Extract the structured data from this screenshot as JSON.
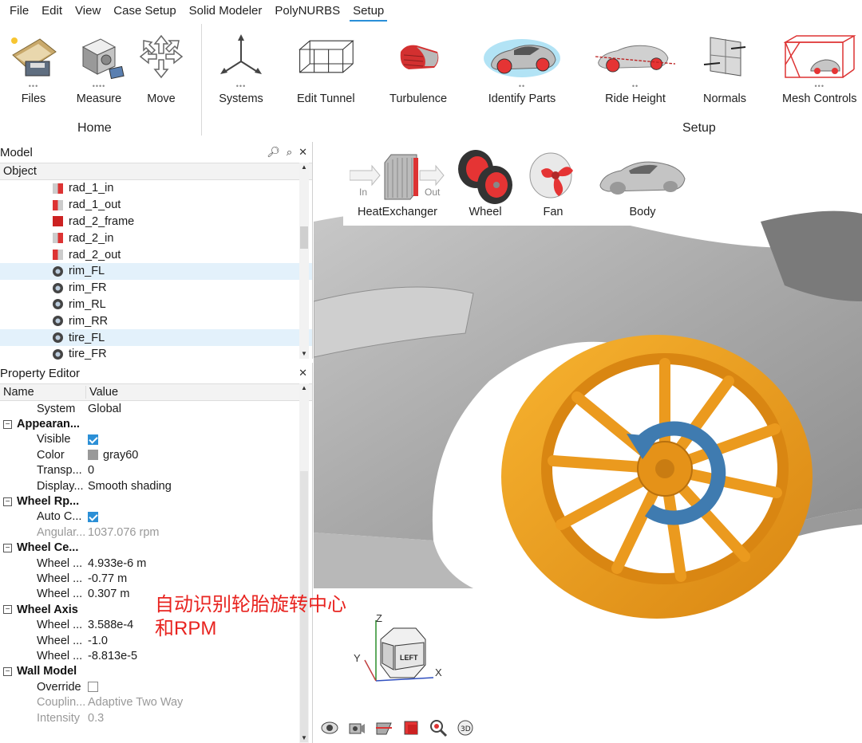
{
  "menubar": {
    "items": [
      "File",
      "Edit",
      "View",
      "Case Setup",
      "Solid Modeler",
      "PolyNURBS",
      "Setup"
    ],
    "active": "Setup"
  },
  "ribbon": {
    "tools": {
      "files": "Files",
      "measure": "Measure",
      "move": "Move",
      "systems": "Systems",
      "edit_tunnel": "Edit Tunnel",
      "turbulence": "Turbulence",
      "identify_parts": "Identify Parts",
      "ride_height": "Ride Height",
      "normals": "Normals",
      "mesh_controls": "Mesh Controls"
    },
    "groups": {
      "home": "Home",
      "setup": "Setup"
    }
  },
  "subbar": {
    "heat_exchanger": "HeatExchanger",
    "in_label": "In",
    "out_label": "Out",
    "wheel": "Wheel",
    "fan": "Fan",
    "body": "Body"
  },
  "model_panel": {
    "title": "Model",
    "column": "Object",
    "items": [
      {
        "label": "rad_1_in",
        "kind": "in"
      },
      {
        "label": "rad_1_out",
        "kind": "out"
      },
      {
        "label": "rad_2_frame",
        "kind": "frame"
      },
      {
        "label": "rad_2_in",
        "kind": "in"
      },
      {
        "label": "rad_2_out",
        "kind": "out"
      },
      {
        "label": "rim_FL",
        "kind": "rim",
        "selected": true
      },
      {
        "label": "rim_FR",
        "kind": "rim"
      },
      {
        "label": "rim_RL",
        "kind": "rim"
      },
      {
        "label": "rim_RR",
        "kind": "rim"
      },
      {
        "label": "tire_FL",
        "kind": "rim",
        "selected": true
      },
      {
        "label": "tire_FR",
        "kind": "rim"
      }
    ]
  },
  "property_editor": {
    "title": "Property Editor",
    "col_name": "Name",
    "col_value": "Value",
    "system": {
      "k": "System",
      "v": "Global"
    },
    "appearance": {
      "group": "Appearan...",
      "visible_k": "Visible",
      "color_k": "Color",
      "color_v": "gray60",
      "transp_k": "Transp...",
      "transp_v": "0",
      "display_k": "Display...",
      "display_v": "Smooth shading"
    },
    "wheel_rpm": {
      "group": "Wheel Rp...",
      "auto_k": "Auto C...",
      "angular_k": "Angular...",
      "angular_v": "1037.076 rpm"
    },
    "wheel_center": {
      "group": "Wheel Ce...",
      "r1_k": "Wheel ...",
      "r1_v": "4.933e-6 m",
      "r2_k": "Wheel ...",
      "r2_v": "-0.77 m",
      "r3_k": "Wheel ...",
      "r3_v": "0.307 m"
    },
    "wheel_axis": {
      "group": "Wheel Axis",
      "r1_k": "Wheel ...",
      "r1_v": "3.588e-4",
      "r2_k": "Wheel ...",
      "r2_v": "-1.0",
      "r3_k": "Wheel ...",
      "r3_v": "-8.813e-5"
    },
    "wall_model": {
      "group": "Wall Model",
      "override_k": "Override",
      "coupling_k": "Couplin...",
      "coupling_v": "Adaptive Two Way",
      "intensity_k": "Intensity",
      "intensity_v": "0.3"
    }
  },
  "viewport": {
    "annotation": "自动识别轮胎旋转中心和RPM",
    "axes": {
      "z": "Z",
      "y": "Y",
      "x": "X"
    },
    "cube_face": "LEFT"
  },
  "colors": {
    "accent": "#2a8fd8",
    "wheel": "#f0a020",
    "rotation_arrow": "#3f7bb0",
    "annotation": "#e8231f"
  }
}
